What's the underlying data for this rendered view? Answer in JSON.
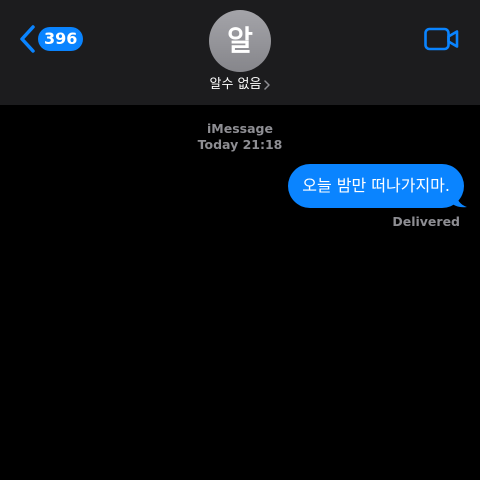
{
  "header": {
    "back_count": "396",
    "contact_initial": "알",
    "contact_name": "알수 없음"
  },
  "conversation": {
    "service": "iMessage",
    "date_time": "Today 21:18",
    "messages": [
      {
        "direction": "outgoing",
        "text": "오늘 밤만 떠나가지마.",
        "status": "Delivered"
      }
    ]
  },
  "icons": {
    "back": "chevron-left-icon",
    "contact_disclosure": "chevron-right-icon",
    "video": "video-camera-icon"
  },
  "colors": {
    "accent": "#0a84ff",
    "header_bg": "#1c1c1e",
    "background": "#000000",
    "secondary_text": "#8e8e93",
    "avatar": "#98989d"
  }
}
